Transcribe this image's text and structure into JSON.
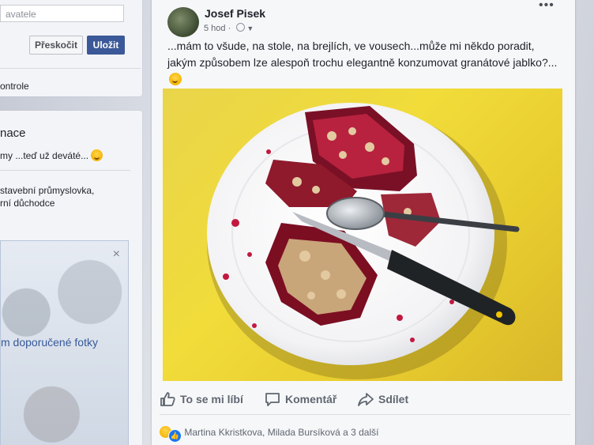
{
  "left_top": {
    "name_placeholder": "avatele",
    "skip_label": "Přeskočit",
    "save_label": "Uložit",
    "control_text": "ontrole"
  },
  "left_mid": {
    "heading": "nace",
    "line1": "my ...teď už deváté...",
    "line2": "stavební průmyslovka,",
    "line3": "rní důchodce"
  },
  "photo_card": {
    "close": "×",
    "link": "m doporučené fotky"
  },
  "post": {
    "author": "Josef Pisek",
    "time": "5 hod",
    "more": "•••",
    "text": "...mám to všude, na stole, na brejlích, ve vousech...může mi někdo poradit, jakým způsobem lze alespoň trochu elegantně konzumovat granátové jablko?...",
    "actions": {
      "like": "To se mi líbí",
      "comment": "Komentář",
      "share": "Sdílet"
    },
    "reactions_text": "Martina Kkristkova, Milada Bursíková a 3 další"
  },
  "colors": {
    "fb_blue": "#3b5998",
    "link_blue": "#365899",
    "photo_background": "#ecd43a"
  }
}
